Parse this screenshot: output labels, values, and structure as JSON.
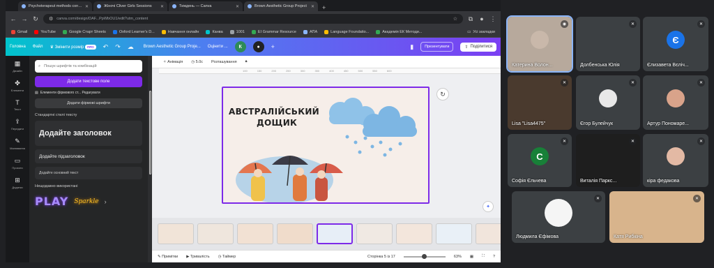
{
  "browser": {
    "tabs": [
      {
        "title": "Psychoterapeut methods conver",
        "active": false
      },
      {
        "title": "Жіночі Cliver Girls Sessions",
        "active": false
      },
      {
        "title": "Тиждень — Canva",
        "active": false
      },
      {
        "title": "Brown Aesthetic Group Project",
        "active": true
      }
    ],
    "url": "canva.com/design/DAF...PpWbOU1/edit?utm_content",
    "bookmarks": [
      {
        "label": "Gmail",
        "color": "#ea4335"
      },
      {
        "label": "YouTube",
        "color": "#ff0000"
      },
      {
        "label": "Google Старт Sheets",
        "color": "#34a853"
      },
      {
        "label": "Oxford Learner's D...",
        "color": "#1a73e8"
      },
      {
        "label": "Навчання онлайн",
        "color": "#fbbc04"
      },
      {
        "label": "Канва",
        "color": "#00c4cc"
      },
      {
        "label": "1001",
        "color": "#9aa0a6"
      },
      {
        "label": "EI Grammar Resource",
        "color": "#34a853"
      },
      {
        "label": "АПА",
        "color": "#8ab4f8"
      },
      {
        "label": "Language Foundatio...",
        "color": "#fbbc04"
      },
      {
        "label": "Академія ЕК Методи...",
        "color": "#34a853"
      }
    ],
    "bookmarks_all": "Усі закладки"
  },
  "canva": {
    "toolbar": {
      "home": "Головна",
      "file": "Файл",
      "resize": "Змінити розмір",
      "resize_badge": "ПРО",
      "title": "Brown Aesthetic Group Proje...",
      "present_label": "Презентувати",
      "share_label": "Поділитися",
      "avatar_k": "К",
      "comment_label": "Оцінити ..."
    },
    "rail": [
      {
        "icon": "▦",
        "label": "Дизайн",
        "name": "design-icon"
      },
      {
        "icon": "✤",
        "label": "Елементи",
        "name": "elements-icon"
      },
      {
        "icon": "T",
        "label": "Текст",
        "name": "text-icon"
      },
      {
        "icon": "⇪",
        "label": "Передати",
        "name": "upload-icon"
      },
      {
        "icon": "✎",
        "label": "Малювання",
        "name": "draw-icon"
      },
      {
        "icon": "▭",
        "label": "Проєкти",
        "name": "projects-icon"
      },
      {
        "icon": "⊞",
        "label": "Додатки",
        "name": "apps-icon"
      }
    ],
    "panel": {
      "search_placeholder": "Пошук шрифтів та комбінацій",
      "add_text_box": "Додати текстове поле",
      "brand_kit": "Елементи фірмового ст...  Редагувати",
      "add_brand_fonts": "Додати фірмові шрифти",
      "default_styles": "Стандартні стилі тексту",
      "heading": "Додайте заголовок",
      "subheading": "Додайте підзаголовок",
      "body": "Додайте основний текст",
      "recent": "Нещодавно використані",
      "font_play": "PLAY",
      "font_sparkle": "Sparkle"
    },
    "editor": {
      "animate": "Анімація",
      "duration": "5.0с",
      "position": "Розташування",
      "ruler_ticks": [
        "100",
        "150",
        "200",
        "250",
        "300",
        "350",
        "400",
        "450",
        "500",
        "550",
        "600"
      ],
      "slide_title_line1": "АВСТРАЛІЙСЬКИЙ",
      "slide_title_line2": "ДОЩИК"
    },
    "footer": {
      "notes": "Примітки",
      "duration": "Тривалість",
      "timer": "Таймер",
      "pages": "Сторінка 5 із 17",
      "zoom": "63%"
    },
    "thumb_colors": [
      "#f1e4d8",
      "#efe6dd",
      "#f2e1d3",
      "#f0dccb",
      "#e7eef7",
      "#f0e9e3",
      "#f3e6dc",
      "#e9f0f7",
      "#f1e5dc"
    ]
  },
  "meet": {
    "tiles": [
      {
        "name": "Катерина Волон...",
        "initial": "",
        "bg": "#b7a99c",
        "avatar": "#c9b8aa",
        "speaking": true
      },
      {
        "name": "Долбенська Юлія",
        "initial": "",
        "bg": "#3c4043"
      },
      {
        "name": "Єлизавета Вєліч...",
        "initial": "Є",
        "bg": "#3c4043",
        "avatar": "#1a73e8"
      },
      {
        "name": "Lisa \"Lisa4475\"",
        "initial": "",
        "bg": "#4a3a2e"
      },
      {
        "name": "Єгор Булейчук",
        "initial": "",
        "bg": "#3c4043",
        "avatar": "#e8e8e8"
      },
      {
        "name": "Артур Пономаре...",
        "initial": "",
        "bg": "#3c4043",
        "avatar": "#d9a38a"
      },
      {
        "name": "Софія Єльчева",
        "initial": "С",
        "bg": "#3c4043",
        "avatar": "#188038"
      },
      {
        "name": "Виталія Паркс...",
        "initial": "",
        "bg": "#1e1e1e"
      },
      {
        "name": "кіра федакова",
        "initial": "",
        "bg": "#3c4043",
        "avatar": "#e3b9a4"
      },
      {
        "name": "Людмила Єфімова",
        "initial": "",
        "bg": "#3c4043",
        "avatar": "#f5f5f5"
      },
      {
        "name": "Катя Рибкіна",
        "initial": "",
        "bg": "#d8b48c"
      }
    ]
  }
}
